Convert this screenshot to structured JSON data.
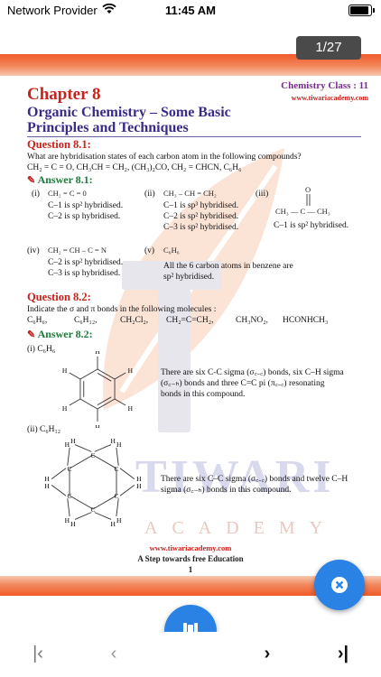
{
  "status_bar": {
    "carrier": "Network Provider",
    "time": "11:45 AM"
  },
  "viewer": {
    "page_indicator": "1/27"
  },
  "page": {
    "chapter": "Chapter 8",
    "class_label": "Chemistry Class : 11",
    "site_top": "www.tiwariacademy.com",
    "title_line1": "Organic Chemistry – Some Basic",
    "title_line2": "Principles and Techniques",
    "q1": {
      "heading": "Question 8.1:",
      "text": "What are hybridisation states of each carbon atom in the following compounds?",
      "compounds": "CH₂ = C = O,   CH₃CH = CH₂, (CH₃)₂CO,  CH₂ = CHCN, C₆H₆"
    },
    "a1": {
      "heading": "Answer 8.1:",
      "i_label": "(i)",
      "i_formula": "CH₂ = C = 0",
      "i_l1": "C–1 is sp² hybridised.",
      "i_l2": "C–2 is sp hybridised.",
      "ii_label": "(ii)",
      "ii_formula": "CH₃ – CH = CH₂",
      "ii_l1": "C–1 is sp³ hybridised.",
      "ii_l2": "C–2 is sp² hybridised.",
      "ii_l3": "C–3 is sp² hybridised.",
      "iii_label": "(iii)",
      "iii_o": "O",
      "iii_formula": "CH₃ — C — CH₃",
      "iii_l1": "C–1 is sp² hybridised.",
      "iv_label": "(iv)",
      "iv_formula": "CH₂ = CH – C = N",
      "iv_l1": "C–2 is sp² hybridised.",
      "iv_l2": "C–3 is sp hybridised.",
      "v_label": "(v)",
      "v_formula": "C₆H₆",
      "v_l1": "All the 6 carbon atoms in benzene are",
      "v_l2": "sp² hybridised."
    },
    "q2": {
      "heading": "Question 8.2:",
      "text": "Indicate the σ and π bonds in the following molecules :",
      "molecules": [
        "C₆H₆,",
        "C₆H₁₂,",
        "CH₂Cl₂,",
        "CH₂=C=CH₂,",
        "CH₃NO₂,",
        "HCONHCH₃"
      ]
    },
    "a2": {
      "heading": "Answer 8.2:",
      "i_label": "(i) C₆H₆",
      "i_l1": "There are six C-C sigma (σ꜀₋꜀) bonds, six C–H sigma",
      "i_l2": "(σ꜀₋ₕ) bonds and three C=C pi (π꜀₋꜀) resonating",
      "i_l3": "bonds in this compound.",
      "ii_label": "(ii) C₆H₁₂",
      "ii_l1": "There are six C–C sigma (σ꜀₋꜀) bonds and twelve C–H",
      "ii_l2": "sigma (σ꜀₋ₕ) bonds in this compound.",
      "atom_c": "C",
      "atom_h": "H"
    },
    "watermark": {
      "brand": "TIWARI",
      "sub": "ACADEMY"
    },
    "footer": {
      "site": "www.tiwariacademy.com",
      "tagline": "A Step towards free Education",
      "page_number": "1"
    }
  },
  "nav": {
    "first": "|‹",
    "prev": "‹",
    "next": "›",
    "last": "›|"
  },
  "colors": {
    "accent_blue": "#2a82e4",
    "band_orange": "#f05a2a",
    "chapter_red": "#c8231c",
    "title_purple": "#3a2a8a"
  }
}
